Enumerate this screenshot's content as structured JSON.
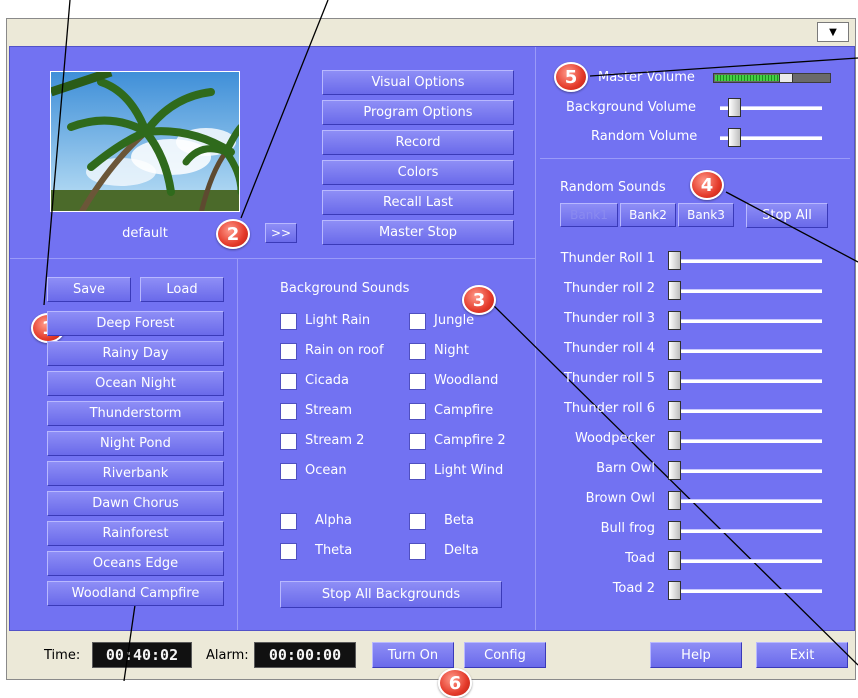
{
  "presets": {
    "current_name": "default",
    "more_label": ">>",
    "save_label": "Save",
    "load_label": "Load",
    "items": [
      "Deep Forest",
      "Rainy Day",
      "Ocean Night",
      "Thunderstorm",
      "Night Pond",
      "Riverbank",
      "Dawn Chorus",
      "Rainforest",
      "Oceans Edge",
      "Woodland Campfire"
    ]
  },
  "menu": {
    "visual_options": "Visual Options",
    "program_options": "Program Options",
    "record": "Record",
    "colors": "Colors",
    "recall_last": "Recall Last",
    "master_stop": "Master Stop"
  },
  "background": {
    "title": "Background Sounds",
    "left": [
      "Light Rain",
      "Rain on roof",
      "Cicada",
      "Stream",
      "Stream 2",
      "Ocean"
    ],
    "right": [
      "Jungle",
      "Night",
      "Woodland",
      "Campfire",
      "Campfire 2",
      "Light Wind"
    ],
    "waves_left": [
      "Alpha",
      "Theta"
    ],
    "waves_right": [
      "Beta",
      "Delta"
    ],
    "stop_all_label": "Stop All Backgrounds"
  },
  "volume": {
    "master_label": "Master Volume",
    "master_level": 0.62,
    "background_label": "Background Volume",
    "background_level": 0.14,
    "random_label": "Random Volume",
    "random_level": 0.14
  },
  "random": {
    "title": "Random Sounds",
    "banks": [
      "Bank1",
      "Bank2",
      "Bank3"
    ],
    "stop_all_label": "Stop All",
    "sounds": [
      "Thunder Roll 1",
      "Thunder roll 2",
      "Thunder roll 3",
      "Thunder roll 4",
      "Thunder roll 5",
      "Thunder roll 6",
      "Woodpecker",
      "Barn Owl",
      "Brown Owl",
      "Bull frog",
      "Toad",
      "Toad 2"
    ]
  },
  "status": {
    "time_label": "Time:",
    "time_value": "00:40:02",
    "alarm_label": "Alarm:",
    "alarm_value": "00:00:00",
    "turn_on_label": "Turn On",
    "config_label": "Config",
    "help_label": "Help",
    "exit_label": "Exit"
  },
  "callouts": [
    "1",
    "2",
    "3",
    "4",
    "5",
    "6"
  ],
  "dropdown_glyph": "▼"
}
